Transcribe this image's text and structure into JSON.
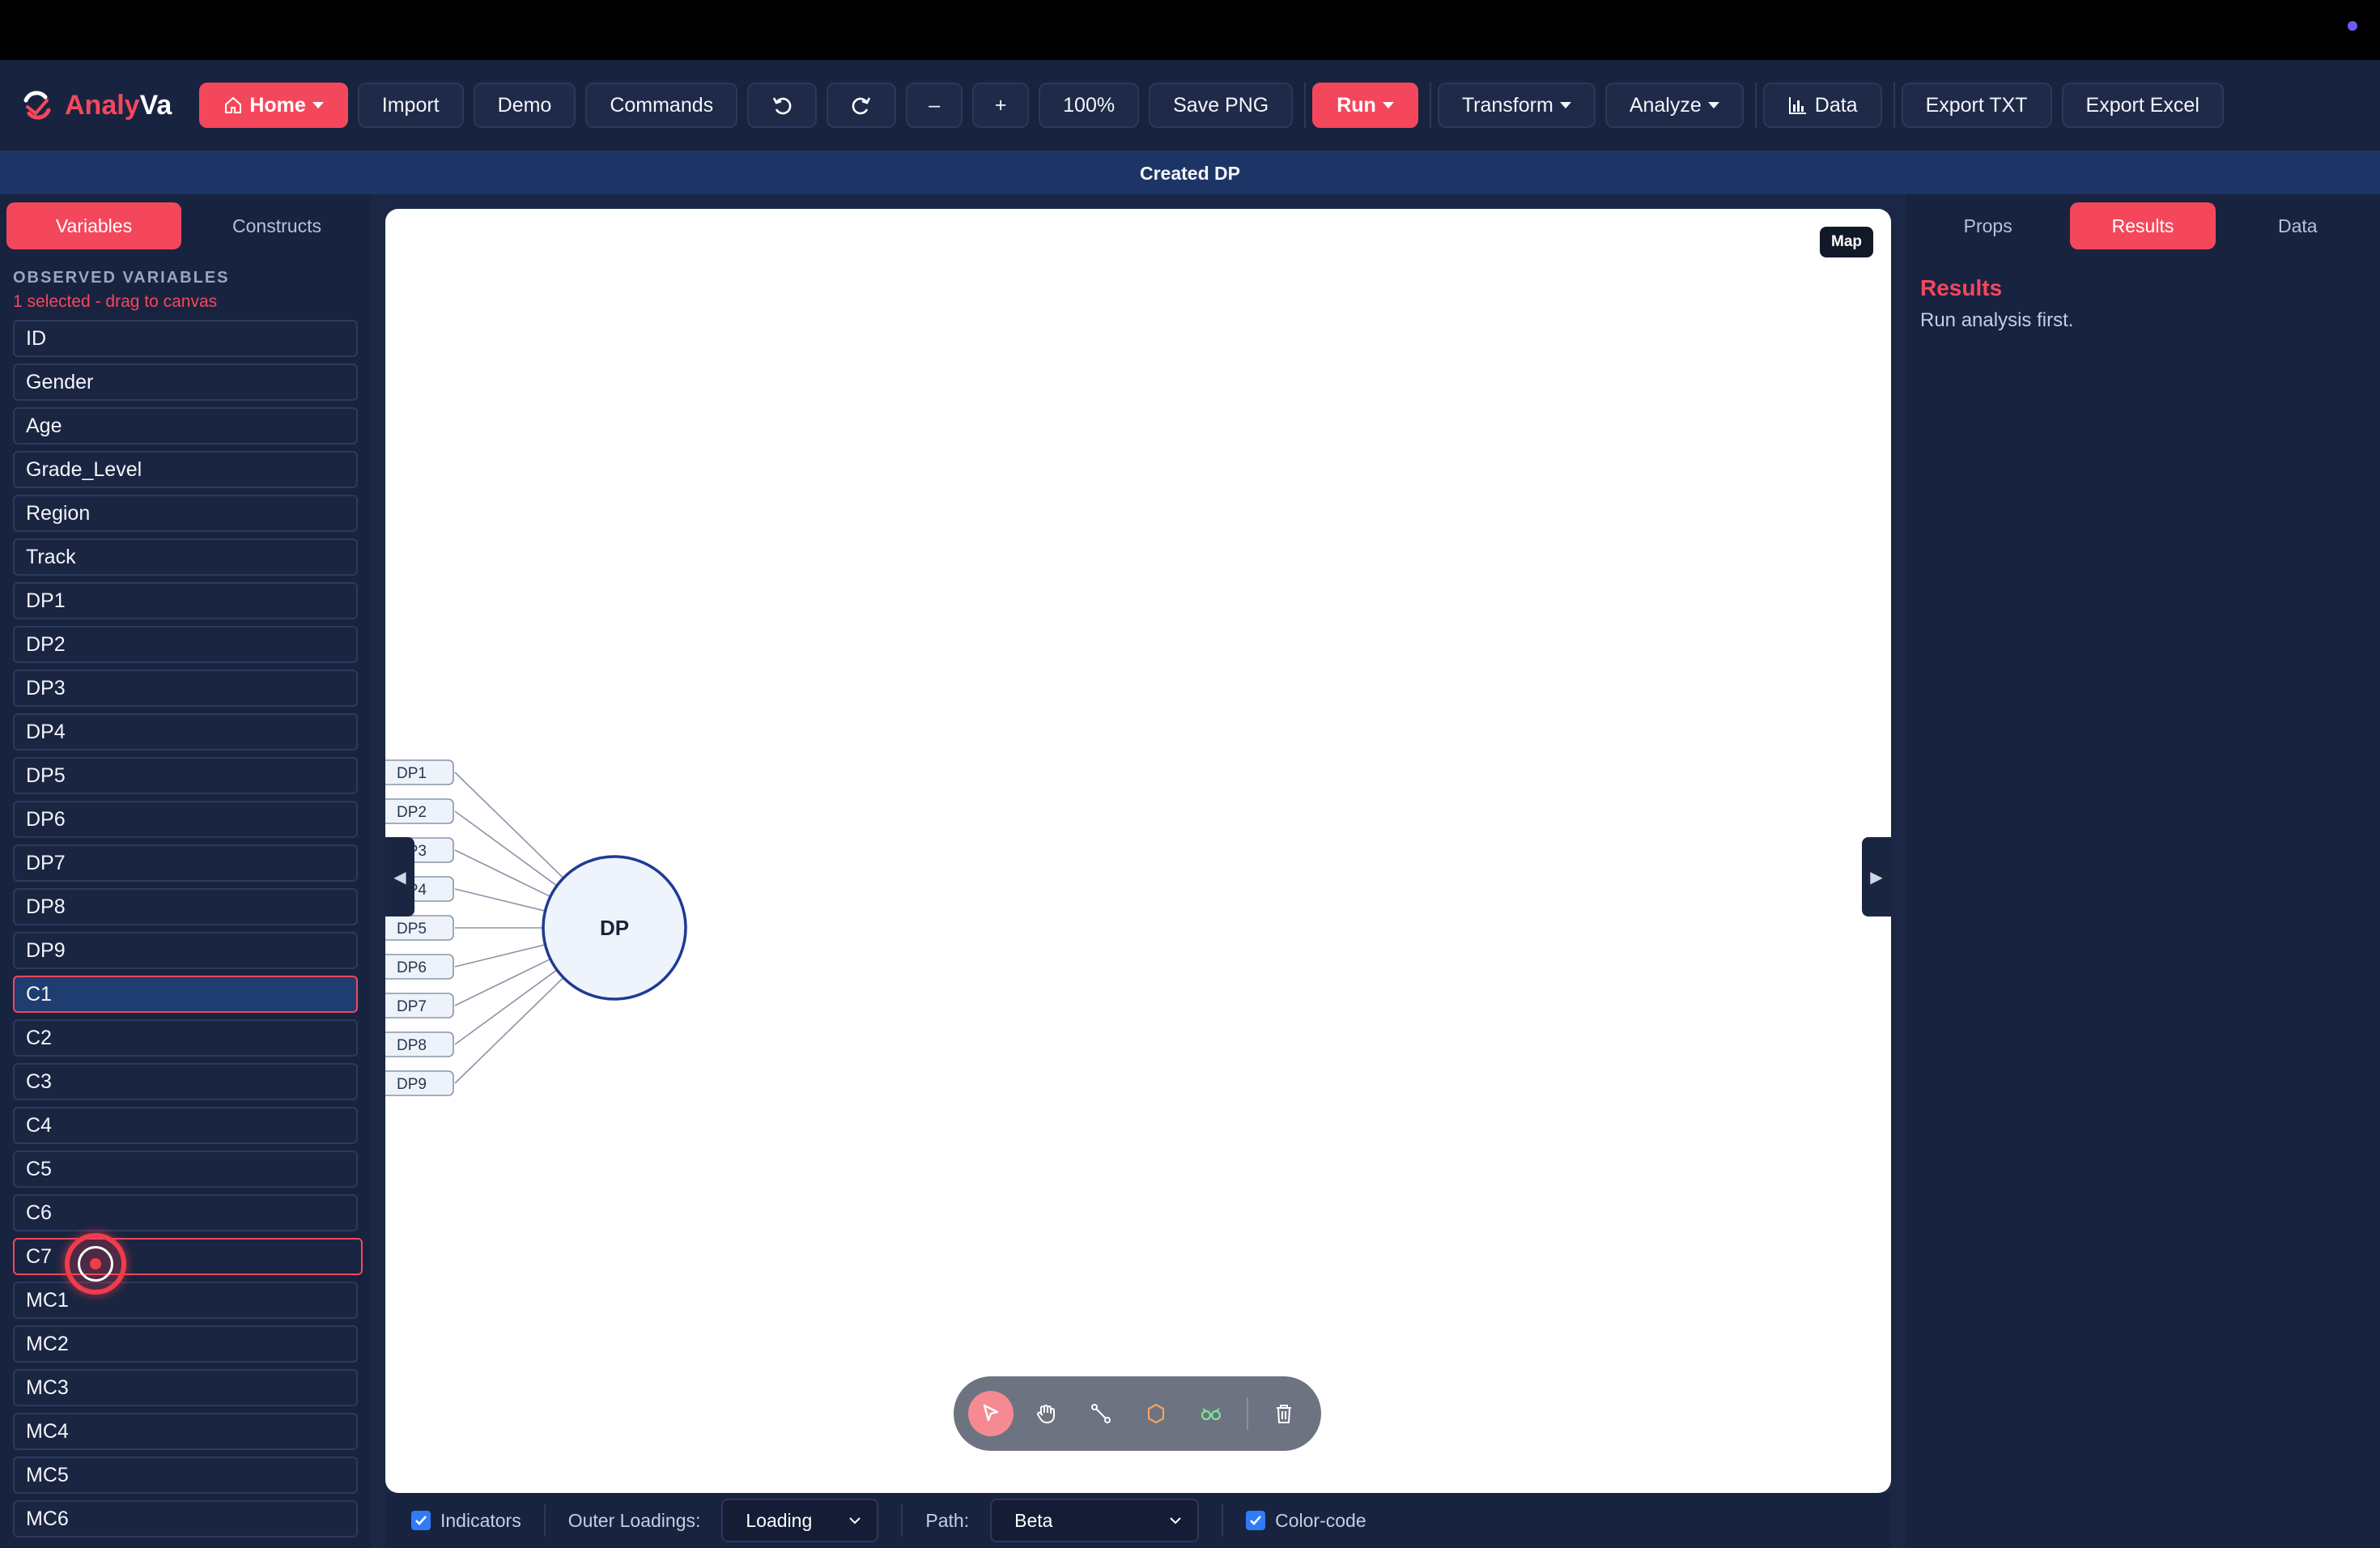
{
  "app": {
    "name_part1": "Analy",
    "name_part2": "Va"
  },
  "toolbar": {
    "home_label": "Home",
    "import_label": "Import",
    "demo_label": "Demo",
    "commands_label": "Commands",
    "zoom_out_label": "–",
    "zoom_in_label": "+",
    "zoom_level": "100%",
    "save_png_label": "Save PNG",
    "run_label": "Run",
    "transform_label": "Transform",
    "analyze_label": "Analyze",
    "data_label": "Data",
    "export_txt_label": "Export TXT",
    "export_excel_label": "Export Excel"
  },
  "banner": {
    "text": "Created DP"
  },
  "left_panel": {
    "tabs": [
      {
        "label": "Variables",
        "active": true
      },
      {
        "label": "Constructs",
        "active": false
      }
    ],
    "section_title": "OBSERVED VARIABLES",
    "selection_hint": "1 selected - drag to canvas",
    "variables": [
      "ID",
      "Gender",
      "Age",
      "Grade_Level",
      "Region",
      "Track",
      "DP1",
      "DP2",
      "DP3",
      "DP4",
      "DP5",
      "DP6",
      "DP7",
      "DP8",
      "DP9",
      "C1",
      "C2",
      "C3",
      "C4",
      "C5",
      "C6",
      "C7",
      "MC1",
      "MC2",
      "MC3",
      "MC4",
      "MC5",
      "MC6"
    ],
    "selected_variable": "C1",
    "hovered_variable": "C7"
  },
  "canvas": {
    "map_label": "Map",
    "construct_label": "DP",
    "indicators": [
      "DP1",
      "DP2",
      "DP3",
      "DP4",
      "DP5",
      "DP6",
      "DP7",
      "DP8",
      "DP9"
    ]
  },
  "bottom_bar": {
    "indicators_label": "Indicators",
    "indicators_checked": true,
    "outer_loadings_label": "Outer Loadings:",
    "outer_loadings_value": "Loading",
    "path_label": "Path:",
    "path_value": "Beta",
    "color_code_label": "Color-code",
    "color_code_checked": true
  },
  "right_panel": {
    "tabs": [
      {
        "label": "Props",
        "active": false
      },
      {
        "label": "Results",
        "active": true
      },
      {
        "label": "Data",
        "active": false
      }
    ],
    "results_title": "Results",
    "results_message": "Run analysis first."
  },
  "colors": {
    "accent": "#f5475c",
    "background": "#1b2745",
    "construct_stroke": "#1f3a93",
    "construct_fill": "#eef3fc"
  }
}
